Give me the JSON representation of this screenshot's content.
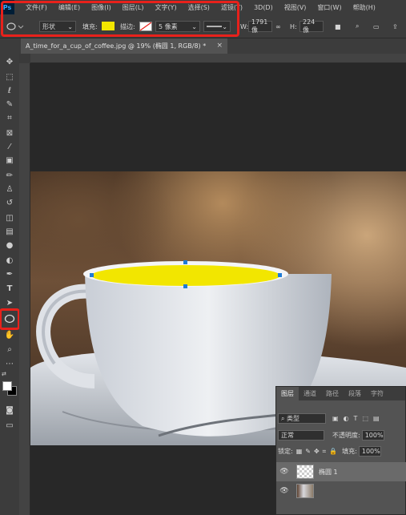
{
  "menu": {
    "logo": "Ps",
    "items": [
      "文件(F)",
      "编辑(E)",
      "图像(I)",
      "图层(L)",
      "文字(Y)",
      "选择(S)",
      "滤镜(T)",
      "3D(D)",
      "视图(V)",
      "窗口(W)",
      "帮助(H)"
    ]
  },
  "options": {
    "mode": "形状",
    "fill_label": "填充:",
    "fill_color": "#f2e600",
    "stroke_label": "描边:",
    "stroke_size": "5 像素",
    "w_label": "W:",
    "w_value": "1791 像",
    "link_icon": "link-icon",
    "h_label": "H:",
    "h_value": "224 像"
  },
  "document": {
    "tab_title": "A_time_for_a_cup_of_coffee.jpg @ 19% (椭圆 1, RGB/8) *",
    "close": "×"
  },
  "tools": [
    "move-icon",
    "marquee-icon",
    "lasso-icon",
    "quick-select-icon",
    "crop-icon",
    "frame-icon",
    "eyedropper-icon",
    "healing-icon",
    "brush-icon",
    "stamp-icon",
    "history-brush-icon",
    "eraser-icon",
    "gradient-icon",
    "blur-icon",
    "dodge-icon",
    "pen-icon",
    "type-icon",
    "path-select-icon",
    "ellipse-icon",
    "hand-icon",
    "zoom-icon",
    "more-icon"
  ],
  "canvas": {
    "ellipse_color": "#f2e600",
    "anchor_color": "#1f7bd6"
  },
  "layers_panel": {
    "tabs": [
      "图层",
      "通道",
      "路径",
      "段落",
      "字符"
    ],
    "filter_label": "类型",
    "blend_mode": "正常",
    "opacity_label": "不透明度:",
    "opacity_value": "100%",
    "lock_label": "锁定:",
    "fill_label": "填充:",
    "fill_value": "100%",
    "layers": [
      {
        "name": "椭圆 1"
      },
      {
        "name": ""
      }
    ]
  }
}
